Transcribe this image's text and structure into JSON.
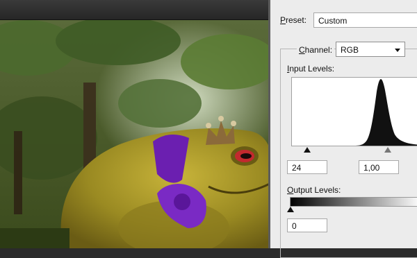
{
  "levels_dialog": {
    "preset": {
      "label_mnemonic": "P",
      "label_rest": "reset:",
      "value": "Custom"
    },
    "channel": {
      "label_mnemonic": "C",
      "label_rest": "hannel:",
      "value": "RGB"
    },
    "input_levels": {
      "label_mnemonic": "I",
      "label_rest": "nput Levels:",
      "black": "24",
      "gamma": "1,00"
    },
    "output_levels": {
      "label_mnemonic": "O",
      "label_rest": "utput Levels:",
      "black": "0"
    }
  }
}
